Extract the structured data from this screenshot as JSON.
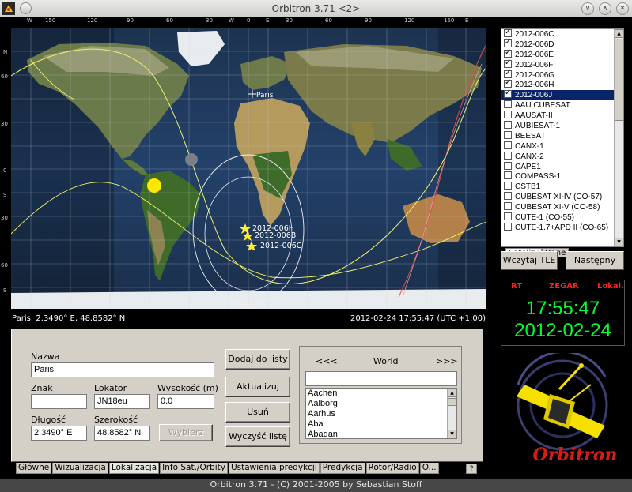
{
  "window": {
    "title": "Orbitron 3.71 <2>"
  },
  "map": {
    "top_scale": [
      "W",
      "150",
      "120",
      "90",
      "60",
      "30",
      "W",
      "0",
      "E",
      "30",
      "60",
      "90",
      "120",
      "150",
      "E"
    ],
    "left_scale": [
      "N",
      "60",
      "30",
      "0",
      "S",
      "30",
      "60",
      "S"
    ],
    "location_label": "Paris",
    "sat_labels": [
      "2012-006H",
      "2012-006B",
      "2012-006C"
    ],
    "status_left": "Paris: 2.3490° E, 48.8582° N",
    "status_right": "2012-02-24 17:55:47 (UTC +1:00)"
  },
  "satellites": {
    "items": [
      {
        "label": "2012-006C",
        "checked": true,
        "selected": false
      },
      {
        "label": "2012-006D",
        "checked": true,
        "selected": false
      },
      {
        "label": "2012-006E",
        "checked": true,
        "selected": false
      },
      {
        "label": "2012-006F",
        "checked": true,
        "selected": false
      },
      {
        "label": "2012-006G",
        "checked": true,
        "selected": false
      },
      {
        "label": "2012-006H",
        "checked": true,
        "selected": false
      },
      {
        "label": "2012-006J",
        "checked": true,
        "selected": true
      },
      {
        "label": "AAU CUBESAT",
        "checked": false,
        "selected": false
      },
      {
        "label": "AAUSAT-II",
        "checked": false,
        "selected": false
      },
      {
        "label": "AUBIESAT-1",
        "checked": false,
        "selected": false
      },
      {
        "label": "BEESAT",
        "checked": false,
        "selected": false
      },
      {
        "label": "CANX-1",
        "checked": false,
        "selected": false
      },
      {
        "label": "CANX-2",
        "checked": false,
        "selected": false
      },
      {
        "label": "CAPE1",
        "checked": false,
        "selected": false
      },
      {
        "label": "COMPASS-1",
        "checked": false,
        "selected": false
      },
      {
        "label": "CSTB1",
        "checked": false,
        "selected": false
      },
      {
        "label": "CUBESAT XI-IV (CO-57)",
        "checked": false,
        "selected": false
      },
      {
        "label": "CUBESAT XI-V (CO-58)",
        "checked": false,
        "selected": false
      },
      {
        "label": "CUTE-1 (CO-55)",
        "checked": false,
        "selected": false
      },
      {
        "label": "CUTE-1.7+APD II (CO-65)",
        "checked": false,
        "selected": false
      }
    ],
    "tabs": [
      "Satelity",
      "Dane"
    ],
    "load_tle_button": "Wczytaj TLE",
    "next_button": "Następny"
  },
  "clock": {
    "mode_rt": "RT",
    "mode_clock": "ZEGAR",
    "mode_local": "Lokal.",
    "time": "17:55:47",
    "date": "2012-02-24"
  },
  "logo": {
    "text": "Orbitron"
  },
  "location": {
    "name_label": "Nazwa",
    "name_value": "Paris",
    "sign_label": "Znak",
    "sign_value": "",
    "locator_label": "Lokator",
    "locator_value": "JN18eu",
    "altitude_label": "Wysokość (m)",
    "altitude_value": "0.0",
    "longitude_label": "Długość",
    "longitude_value": "2.3490° E",
    "latitude_label": "Szerokość",
    "latitude_value": "48.8582° N",
    "choose_button": "Wybierz",
    "add_button": "Dodaj do listy",
    "update_button": "Aktualizuj",
    "remove_button": "Usuń",
    "clear_button": "Wyczyść listę",
    "region_prev": "<<<",
    "region_name": "World",
    "region_next": ">>>",
    "search_value": "",
    "cities": [
      "Aachen",
      "Aalborg",
      "Aarhus",
      "Aba",
      "Abadan"
    ]
  },
  "bottom_tabs": [
    "Główne",
    "Wizualizacja",
    "Lokalizacja",
    "Info Sat./Orbity",
    "Ustawienia predykcji",
    "Predykcja",
    "Rotor/Radio",
    "O..."
  ],
  "help_button": "?",
  "statusbar": {
    "text": "Orbitron 3.71 - (C) 2001-2005 by Sebastian Stoff"
  },
  "colors": {
    "clock_green": "#00ff30",
    "clock_red": "#ff2020",
    "selection": "#0a246a",
    "orbit": "#f3f36a",
    "track_red": "#e05050"
  }
}
